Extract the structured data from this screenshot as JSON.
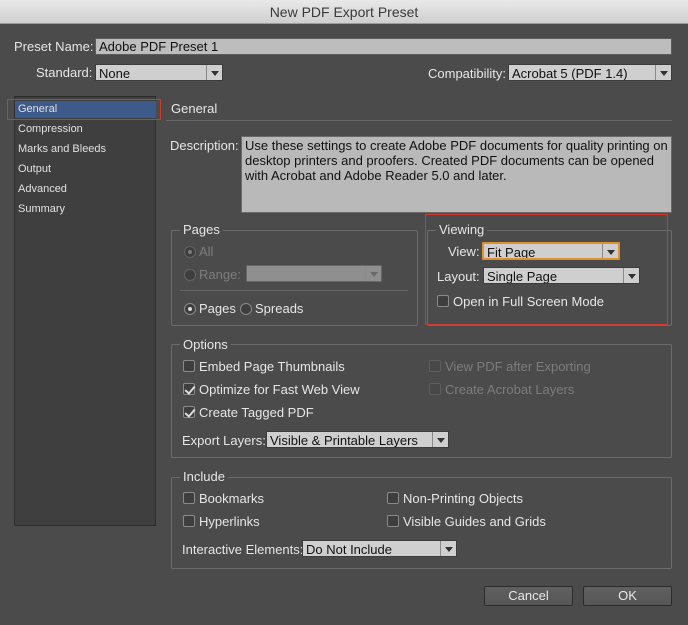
{
  "window": {
    "title": "New PDF Export Preset"
  },
  "preset": {
    "label": "Preset Name:",
    "value": "Adobe PDF Preset 1"
  },
  "standard": {
    "label": "Standard:",
    "value": "None"
  },
  "compatibility": {
    "label": "Compatibility:",
    "value": "Acrobat 5 (PDF 1.4)"
  },
  "sidebar": {
    "items": [
      {
        "label": "General"
      },
      {
        "label": "Compression"
      },
      {
        "label": "Marks and Bleeds"
      },
      {
        "label": "Output"
      },
      {
        "label": "Advanced"
      },
      {
        "label": "Summary"
      }
    ]
  },
  "main": {
    "heading": "General",
    "description_label": "Description:",
    "description_text": "Use these settings to create Adobe PDF documents for quality printing on desktop printers and proofers.  Created PDF documents can be opened with Acrobat and Adobe Reader 5.0 and later."
  },
  "pages": {
    "title": "Pages",
    "all": "All",
    "range": "Range:",
    "pages_opt": "Pages",
    "spreads_opt": "Spreads"
  },
  "viewing": {
    "title": "Viewing",
    "view_label": "View:",
    "view_value": "Fit Page",
    "layout_label": "Layout:",
    "layout_value": "Single Page",
    "fullscreen": "Open in Full Screen Mode"
  },
  "options": {
    "title": "Options",
    "embed_thumbs": "Embed Page Thumbnails",
    "optimize": "Optimize for Fast Web View",
    "tagged": "Create Tagged PDF",
    "view_after": "View PDF after Exporting",
    "acrobat_layers": "Create Acrobat Layers",
    "export_layers_label": "Export Layers:",
    "export_layers_value": "Visible & Printable Layers"
  },
  "include": {
    "title": "Include",
    "bookmarks": "Bookmarks",
    "hyperlinks": "Hyperlinks",
    "nonprinting": "Non-Printing Objects",
    "guides": "Visible Guides and Grids",
    "interactive_label": "Interactive Elements:",
    "interactive_value": "Do Not Include"
  },
  "buttons": {
    "cancel": "Cancel",
    "ok": "OK"
  },
  "colors": {
    "highlight": "#d0392b",
    "focus": "#e0912f",
    "selection": "#3d5a8a"
  }
}
